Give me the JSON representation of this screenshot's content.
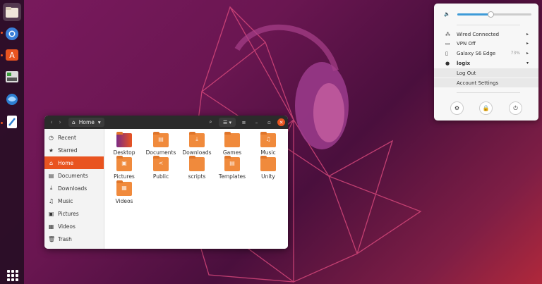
{
  "dock": {
    "items": [
      {
        "name": "files",
        "icon": "files-icon"
      },
      {
        "name": "chromium",
        "icon": "chromium-icon"
      },
      {
        "name": "software",
        "icon": "software-center-icon"
      },
      {
        "name": "settings",
        "icon": "settings-icon"
      },
      {
        "name": "thunderbird",
        "icon": "thunderbird-icon"
      },
      {
        "name": "text-editor",
        "icon": "text-editor-icon"
      }
    ],
    "accent": "#e95420"
  },
  "file_manager": {
    "location": "Home",
    "sidebar": [
      {
        "label": "Recent",
        "icon": "clock-icon",
        "glyph": "◷"
      },
      {
        "label": "Starred",
        "icon": "star-icon",
        "glyph": "★"
      },
      {
        "label": "Home",
        "icon": "home-icon",
        "glyph": "⌂"
      },
      {
        "label": "Documents",
        "icon": "document-icon",
        "glyph": "▤"
      },
      {
        "label": "Downloads",
        "icon": "download-icon",
        "glyph": "⤓"
      },
      {
        "label": "Music",
        "icon": "music-icon",
        "glyph": "♫"
      },
      {
        "label": "Pictures",
        "icon": "picture-icon",
        "glyph": "▣"
      },
      {
        "label": "Videos",
        "icon": "video-icon",
        "glyph": "▦"
      },
      {
        "label": "Trash",
        "icon": "trash-icon",
        "glyph": "🗑"
      }
    ],
    "folders": [
      {
        "label": "Desktop",
        "glyph": ""
      },
      {
        "label": "Documents",
        "glyph": "▤"
      },
      {
        "label": "Downloads",
        "glyph": "⤓"
      },
      {
        "label": "Games",
        "glyph": ""
      },
      {
        "label": "Music",
        "glyph": "♫"
      },
      {
        "label": "Pictures",
        "glyph": "▣"
      },
      {
        "label": "Public",
        "glyph": "<"
      },
      {
        "label": "scripts",
        "glyph": ""
      },
      {
        "label": "Templates",
        "glyph": "▤"
      },
      {
        "label": "Unity",
        "glyph": ""
      },
      {
        "label": "Videos",
        "glyph": "▦"
      }
    ]
  },
  "system_menu": {
    "volume_level": 0.45,
    "items": [
      {
        "label": "Wired Connected",
        "icon": "network-icon",
        "glyph": "⁂",
        "arrow": "▸"
      },
      {
        "label": "VPN Off",
        "icon": "vpn-icon",
        "glyph": "▭",
        "arrow": "▸"
      },
      {
        "label": "Galaxy S6 Edge",
        "icon": "phone-icon",
        "glyph": "▯",
        "extra": "73%",
        "arrow": "▸"
      },
      {
        "label": "logix",
        "icon": "user-icon",
        "glyph": "●",
        "arrow": "▾"
      }
    ],
    "subitems": [
      "Log Out",
      "Account Settings"
    ]
  }
}
